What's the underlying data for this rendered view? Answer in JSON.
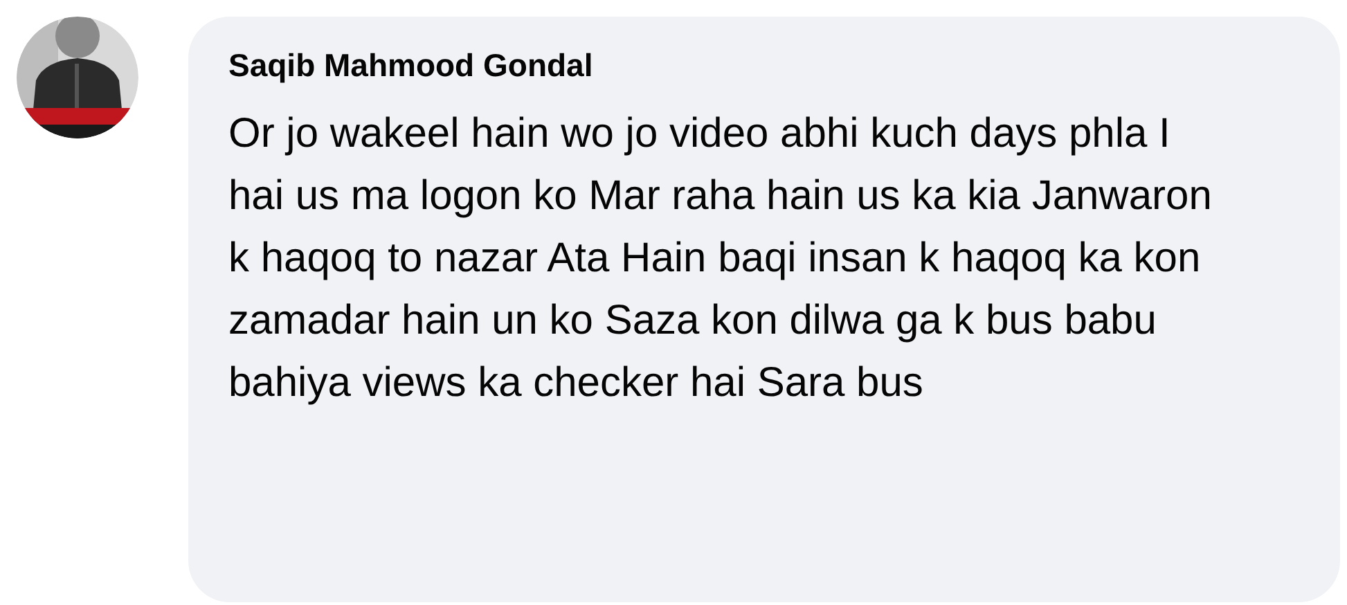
{
  "comment": {
    "author": "Saqib Mahmood Gondal",
    "text": "Or jo wakeel hain wo jo video abhi kuch days phla I hai us ma logon ko Mar raha hain us ka kia Janwaron k haqoq to nazar Ata Hain baqi insan k haqoq ka kon zamadar hain un ko Saza kon dilwa ga k bus babu bahiya views ka checker hai Sara bus"
  }
}
